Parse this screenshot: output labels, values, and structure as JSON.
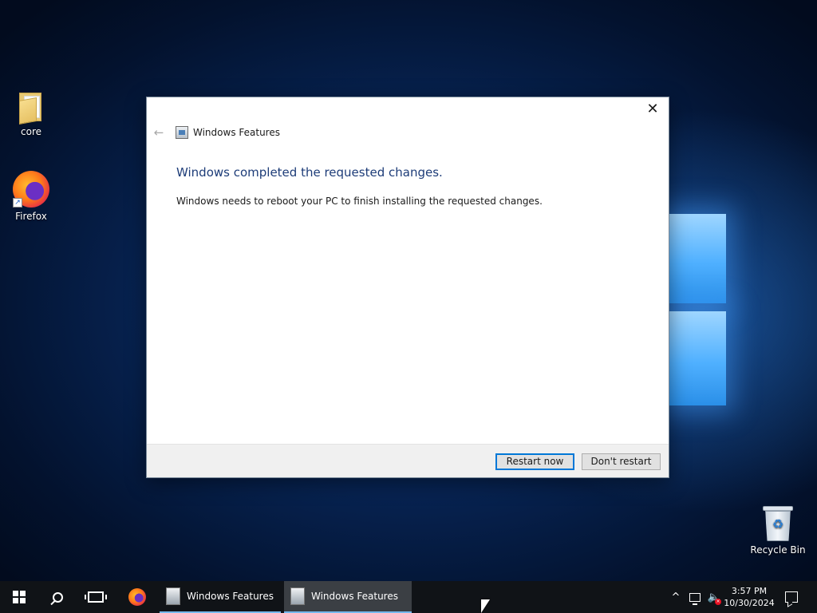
{
  "desktop": {
    "icons": [
      {
        "label": "core",
        "icon": "folder-icon"
      },
      {
        "label": "Firefox",
        "icon": "firefox-icon"
      },
      {
        "label": "Recycle Bin",
        "icon": "recycle-bin-icon"
      }
    ]
  },
  "dialog": {
    "nav_title": "Windows Features",
    "heading": "Windows completed the requested changes.",
    "body": "Windows needs to reboot your PC to finish installing the requested changes.",
    "close_glyph": "✕",
    "back_glyph": "←",
    "buttons": {
      "restart_now": "Restart now",
      "dont_restart": "Don't restart"
    }
  },
  "taskbar": {
    "apps": [
      {
        "label": "Windows Features",
        "icon": "windows-features-icon"
      },
      {
        "label": "Windows Features",
        "icon": "windows-features-icon"
      }
    ],
    "tray": {
      "chevron": "^",
      "volume_glyph": "🔈",
      "muted_glyph": "×"
    },
    "clock": {
      "time": "3:57 PM",
      "date": "10/30/2024"
    }
  },
  "colors": {
    "accent": "#0078d7",
    "heading": "#1d3c78",
    "taskbar": "#101317"
  }
}
